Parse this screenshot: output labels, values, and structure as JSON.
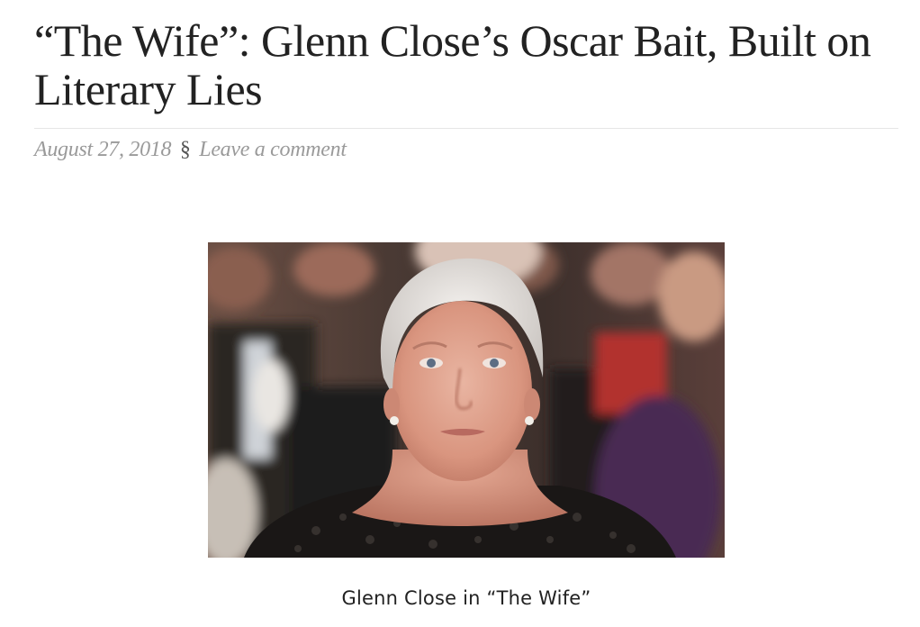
{
  "post": {
    "title": "“The Wife”: Glenn Close’s Oscar Bait, Built on Literary Lies",
    "date": "August 27, 2018",
    "separator": "§",
    "comment_link": "Leave a comment"
  },
  "figure": {
    "image_subject": "portrait-of-woman-with-short-white-hair-in-audience",
    "caption": "Glenn Close in “The Wife”"
  },
  "colors": {
    "title": "#222222",
    "meta": "#9a9a9a",
    "rule": "#e6e6e6",
    "caption": "#222222"
  }
}
